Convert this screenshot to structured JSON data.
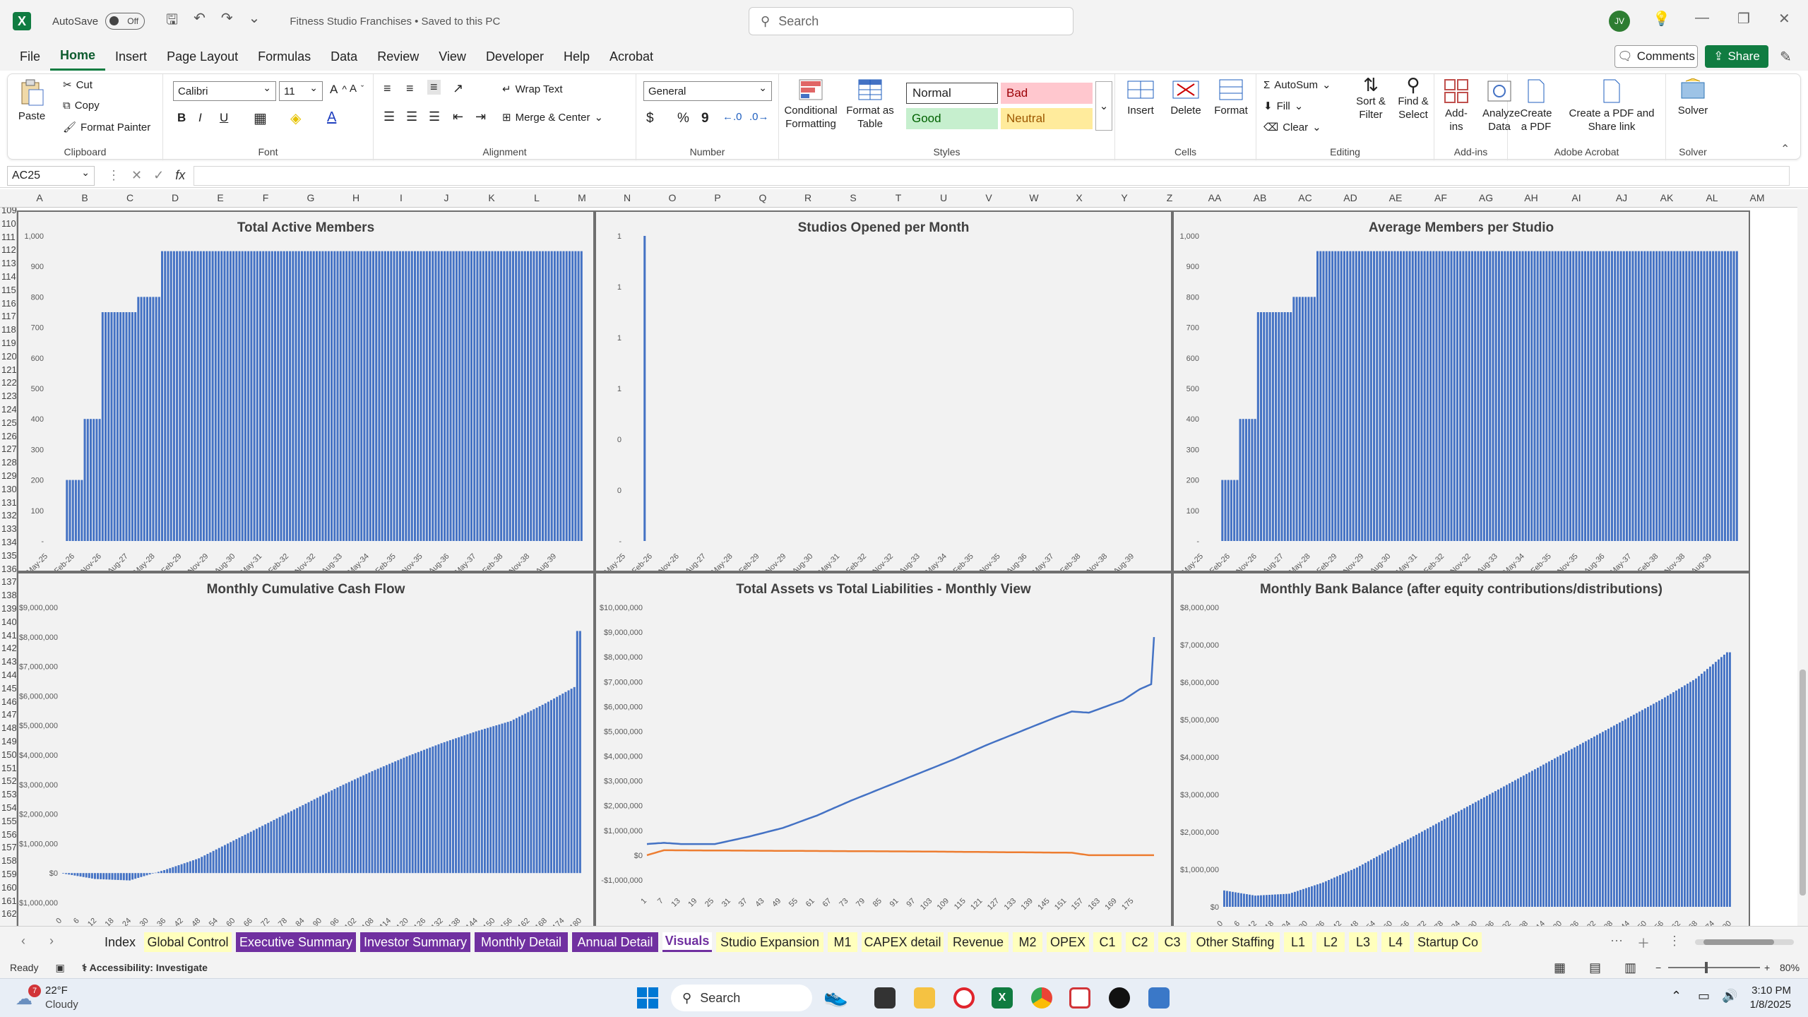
{
  "title_bar": {
    "autosave_label": "AutoSave",
    "autosave_state": "Off",
    "document_title": "Fitness Studio Franchises • Saved to this PC",
    "search_placeholder": "Search",
    "user_initials": "JV"
  },
  "menu": {
    "items": [
      "File",
      "Home",
      "Insert",
      "Page Layout",
      "Formulas",
      "Data",
      "Review",
      "View",
      "Developer",
      "Help",
      "Acrobat"
    ],
    "active": "Home",
    "comments_label": "Comments",
    "share_label": "Share"
  },
  "ribbon": {
    "clipboard": {
      "label": "Clipboard",
      "paste": "Paste",
      "cut": "Cut",
      "copy": "Copy",
      "format_painter": "Format Painter"
    },
    "font": {
      "label": "Font",
      "family": "Calibri",
      "size": "11",
      "bold": "B",
      "italic": "I",
      "underline": "U"
    },
    "alignment": {
      "label": "Alignment",
      "wrap_text": "Wrap Text",
      "merge_center": "Merge & Center"
    },
    "number": {
      "label": "Number",
      "format": "General",
      "currency": "$",
      "percent": "%",
      "comma": "9"
    },
    "styles": {
      "label": "Styles",
      "conditional_formatting": "Conditional Formatting",
      "format_as_table": "Format as Table",
      "normal": "Normal",
      "bad": "Bad",
      "good": "Good",
      "neutral": "Neutral",
      "colors": {
        "normal_bg": "#ffffff",
        "bad_bg": "#ffc7ce",
        "bad_fg": "#9c0006",
        "good_bg": "#c6efce",
        "good_fg": "#006100",
        "neutral_bg": "#ffeb9c",
        "neutral_fg": "#9c5700"
      }
    },
    "cells": {
      "label": "Cells",
      "insert": "Insert",
      "delete": "Delete",
      "format": "Format"
    },
    "editing": {
      "label": "Editing",
      "autosum": "AutoSum",
      "fill": "Fill",
      "clear": "Clear",
      "sort_filter": "Sort & Filter",
      "find_select": "Find & Select"
    },
    "addins": {
      "label": "Add-ins",
      "addins": "Add-ins",
      "analyze_data": "Analyze Data"
    },
    "acrobat": {
      "label": "Adobe Acrobat",
      "create_pdf": "Create a PDF",
      "create_share": "Create a PDF and Share link"
    },
    "solver": {
      "label": "Solver",
      "solver": "Solver"
    }
  },
  "formula_bar": {
    "name_box": "AC25",
    "cancel_icon": "✕",
    "enter_icon": "✓",
    "fx_label": "fx",
    "formula": ""
  },
  "grid": {
    "columns": [
      "A",
      "B",
      "C",
      "D",
      "E",
      "F",
      "G",
      "H",
      "I",
      "J",
      "K",
      "L",
      "M",
      "N",
      "O",
      "P",
      "Q",
      "R",
      "S",
      "T",
      "U",
      "V",
      "W",
      "X",
      "Y",
      "Z",
      "AA",
      "AB",
      "AC",
      "AD",
      "AE",
      "AF",
      "AG",
      "AH",
      "AI",
      "AJ",
      "AK",
      "AL",
      "AM"
    ],
    "rows": [
      "109",
      "110",
      "111",
      "112",
      "113",
      "114",
      "115",
      "116",
      "117",
      "118",
      "119",
      "120",
      "121",
      "122",
      "123",
      "124",
      "125",
      "126",
      "127",
      "128",
      "129",
      "130",
      "131",
      "132",
      "133",
      "134",
      "135",
      "136",
      "137",
      "138",
      "139",
      "140",
      "141",
      "142",
      "143",
      "144",
      "145",
      "146",
      "147",
      "148",
      "149",
      "150",
      "151",
      "152",
      "153",
      "154",
      "155",
      "156",
      "157",
      "158",
      "159",
      "160",
      "161",
      "162"
    ]
  },
  "charts": {
    "date_labels": [
      "May-25",
      "Feb-26",
      "Nov-26",
      "Aug-27",
      "May-28",
      "Feb-29",
      "Nov-29",
      "Aug-30",
      "May-31",
      "Feb-32",
      "Nov-32",
      "Aug-33",
      "May-34",
      "Feb-35",
      "Nov-35",
      "Aug-36",
      "May-37",
      "Feb-38",
      "Nov-38",
      "Aug-39"
    ],
    "month_labels": [
      "0",
      "6",
      "12",
      "18",
      "24",
      "30",
      "36",
      "42",
      "48",
      "54",
      "60",
      "66",
      "72",
      "78",
      "84",
      "90",
      "96",
      "102",
      "108",
      "114",
      "120",
      "126",
      "132",
      "138",
      "144",
      "150",
      "156",
      "162",
      "168",
      "174",
      "180"
    ],
    "line_month_labels": [
      "1",
      "7",
      "13",
      "19",
      "25",
      "31",
      "37",
      "43",
      "49",
      "55",
      "61",
      "67",
      "73",
      "79",
      "85",
      "91",
      "97",
      "103",
      "109",
      "115",
      "121",
      "127",
      "133",
      "139",
      "145",
      "151",
      "157",
      "163",
      "169",
      "175"
    ],
    "bar_color": "#4472c4",
    "line_colors": [
      "#4472c4",
      "#ed7d31"
    ]
  },
  "chart_data": [
    {
      "type": "bar",
      "title": "Total Active Members",
      "x_unit": "month",
      "ylim": [
        0,
        1000
      ],
      "ytick_labels": [
        "-",
        "100",
        "200",
        "300",
        "400",
        "500",
        "600",
        "700",
        "800",
        "900",
        "1,000"
      ],
      "steps": [
        {
          "from": 1,
          "to": 6,
          "value": 0
        },
        {
          "from": 7,
          "to": 12,
          "value": 200
        },
        {
          "from": 13,
          "to": 18,
          "value": 400
        },
        {
          "from": 19,
          "to": 30,
          "value": 750
        },
        {
          "from": 31,
          "to": 38,
          "value": 800
        },
        {
          "from": 39,
          "to": 180,
          "value": 950
        }
      ]
    },
    {
      "type": "bar",
      "title": "Studios Opened per Month",
      "x_unit": "month",
      "ylim": [
        0,
        1
      ],
      "ytick_labels": [
        "-",
        "0",
        "0",
        "1",
        "1",
        "1",
        "1"
      ],
      "spikes": [
        {
          "month": 7,
          "value": 1
        }
      ]
    },
    {
      "type": "bar",
      "title": "Average Members per Studio",
      "x_unit": "month",
      "ylim": [
        0,
        1000
      ],
      "ytick_labels": [
        "-",
        "100",
        "200",
        "300",
        "400",
        "500",
        "600",
        "700",
        "800",
        "900",
        "1,000"
      ],
      "steps": [
        {
          "from": 1,
          "to": 6,
          "value": 0
        },
        {
          "from": 7,
          "to": 12,
          "value": 200
        },
        {
          "from": 13,
          "to": 18,
          "value": 400
        },
        {
          "from": 19,
          "to": 30,
          "value": 750
        },
        {
          "from": 31,
          "to": 38,
          "value": 800
        },
        {
          "from": 39,
          "to": 180,
          "value": 950
        }
      ]
    },
    {
      "type": "bar",
      "title": "Monthly Cumulative Cash Flow",
      "ylim": [
        -1000000,
        9000000
      ],
      "ytick_labels": [
        "-$1,000,000",
        "$0",
        "$1,000,000",
        "$2,000,000",
        "$3,000,000",
        "$4,000,000",
        "$5,000,000",
        "$6,000,000",
        "$7,000,000",
        "$8,000,000",
        "$9,000,000"
      ],
      "points": [
        [
          0,
          0
        ],
        [
          12,
          -200000
        ],
        [
          24,
          -250000
        ],
        [
          36,
          100000
        ],
        [
          48,
          500000
        ],
        [
          60,
          1100000
        ],
        [
          72,
          1700000
        ],
        [
          84,
          2300000
        ],
        [
          96,
          2900000
        ],
        [
          108,
          3450000
        ],
        [
          120,
          3950000
        ],
        [
          132,
          4400000
        ],
        [
          144,
          4800000
        ],
        [
          156,
          5150000
        ],
        [
          168,
          5750000
        ],
        [
          178,
          6300000
        ],
        [
          179,
          8200000
        ]
      ]
    },
    {
      "type": "line",
      "title": "Total Assets vs Total Liabilities - Monthly View",
      "ylim": [
        -1000000,
        10000000
      ],
      "ytick_labels": [
        "-$1,000,000",
        "$0",
        "$1,000,000",
        "$2,000,000",
        "$3,000,000",
        "$4,000,000",
        "$5,000,000",
        "$6,000,000",
        "$7,000,000",
        "$8,000,000",
        "$9,000,000",
        "$10,000,000"
      ],
      "series": [
        {
          "name": "Total Assets",
          "points": [
            [
              1,
              450000
            ],
            [
              7,
              500000
            ],
            [
              13,
              450000
            ],
            [
              25,
              450000
            ],
            [
              37,
              750000
            ],
            [
              49,
              1100000
            ],
            [
              61,
              1600000
            ],
            [
              73,
              2200000
            ],
            [
              85,
              2750000
            ],
            [
              97,
              3300000
            ],
            [
              109,
              3850000
            ],
            [
              121,
              4450000
            ],
            [
              133,
              5000000
            ],
            [
              145,
              5550000
            ],
            [
              151,
              5800000
            ],
            [
              157,
              5750000
            ],
            [
              169,
              6250000
            ],
            [
              175,
              6700000
            ],
            [
              179,
              6900000
            ],
            [
              180,
              8800000
            ]
          ]
        },
        {
          "name": "Total Liabilities",
          "points": [
            [
              1,
              0
            ],
            [
              4,
              100000
            ],
            [
              7,
              200000
            ],
            [
              97,
              150000
            ],
            [
              151,
              100000
            ],
            [
              157,
              0
            ],
            [
              180,
              0
            ]
          ]
        }
      ]
    },
    {
      "type": "bar",
      "title": "Monthly Bank Balance (after equity contributions/distributions)",
      "ylim": [
        0,
        8000000
      ],
      "ytick_labels": [
        "$0",
        "$1,000,000",
        "$2,000,000",
        "$3,000,000",
        "$4,000,000",
        "$5,000,000",
        "$6,000,000",
        "$7,000,000",
        "$8,000,000"
      ],
      "points": [
        [
          0,
          450000
        ],
        [
          12,
          300000
        ],
        [
          24,
          350000
        ],
        [
          36,
          650000
        ],
        [
          48,
          1050000
        ],
        [
          60,
          1550000
        ],
        [
          72,
          2050000
        ],
        [
          84,
          2550000
        ],
        [
          96,
          3050000
        ],
        [
          108,
          3550000
        ],
        [
          120,
          4050000
        ],
        [
          132,
          4550000
        ],
        [
          144,
          5050000
        ],
        [
          156,
          5550000
        ],
        [
          168,
          6100000
        ],
        [
          179,
          6800000
        ]
      ]
    }
  ],
  "sheet_tabs": [
    {
      "label": "Index",
      "style": "plain"
    },
    {
      "label": "Global Control",
      "style": "yellow"
    },
    {
      "label": "Executive Summary",
      "style": "purple"
    },
    {
      "label": "Investor Summary",
      "style": "purple"
    },
    {
      "label": "Monthly Detail",
      "style": "purple"
    },
    {
      "label": "Annual Detail",
      "style": "purple"
    },
    {
      "label": "Visuals",
      "style": "active"
    },
    {
      "label": "Studio Expansion",
      "style": "yellow"
    },
    {
      "label": "M1",
      "style": "yellow"
    },
    {
      "label": "CAPEX detail",
      "style": "yellow"
    },
    {
      "label": "Revenue",
      "style": "yellow"
    },
    {
      "label": "M2",
      "style": "yellow"
    },
    {
      "label": "OPEX",
      "style": "yellow"
    },
    {
      "label": "C1",
      "style": "yellow"
    },
    {
      "label": "C2",
      "style": "yellow"
    },
    {
      "label": "C3",
      "style": "yellow"
    },
    {
      "label": "Other Staffing",
      "style": "yellow"
    },
    {
      "label": "L1",
      "style": "yellow"
    },
    {
      "label": "L2",
      "style": "yellow"
    },
    {
      "label": "L3",
      "style": "yellow"
    },
    {
      "label": "L4",
      "style": "yellow"
    },
    {
      "label": "Startup Co",
      "style": "yellow"
    }
  ],
  "status_bar": {
    "ready": "Ready",
    "accessibility": "Accessibility: Investigate",
    "zoom": "80%"
  },
  "taskbar": {
    "weather_temp": "22°F",
    "weather_desc": "Cloudy",
    "weather_badge": "7",
    "search_label": "Search",
    "time": "3:10 PM",
    "date": "1/8/2025"
  }
}
